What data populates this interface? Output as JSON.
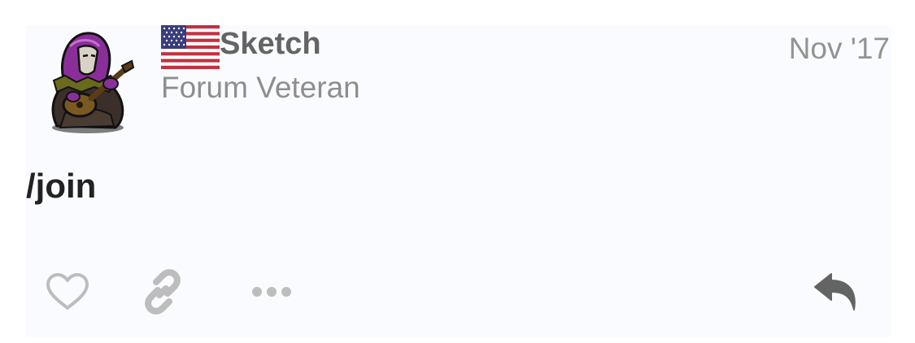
{
  "post": {
    "username": "Sketch",
    "user_title": "Forum Veteran",
    "date": "Nov '17",
    "content": "/join"
  },
  "icons": {
    "avatar": "hooded-bard-avatar",
    "flag": "us-flag-icon",
    "like": "heart-icon",
    "link": "link-icon",
    "more": "ellipsis-icon",
    "reply": "reply-icon"
  },
  "colors": {
    "icon_gray": "#bdbdbd",
    "reply_gray": "#646464",
    "post_bg": "#fafbfe"
  }
}
